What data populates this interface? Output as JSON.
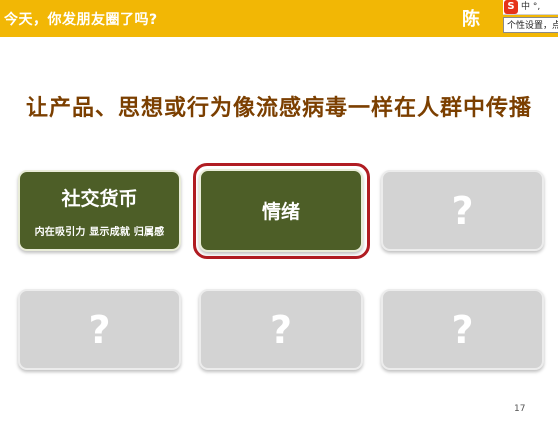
{
  "header": {
    "title": "今天，你发朋友圈了吗?",
    "right_partial": "陈",
    "ime_logo": "S",
    "ime_text": "中 °,"
  },
  "tooltip": {
    "text": "个性设置，点"
  },
  "slide": {
    "title": "让产品、思想或行为像流感病毒一样在人群中传播",
    "cards": [
      {
        "label": "社交货币",
        "sub": "内在吸引力 显示成就 归属感"
      },
      {
        "label": "情绪"
      },
      {
        "label": "?"
      },
      {
        "label": "?"
      },
      {
        "label": "?"
      },
      {
        "label": "?"
      }
    ],
    "page_number": "17"
  },
  "colors": {
    "header": "#f2b705",
    "title": "#7b3f00",
    "card_green": "#4d5e27",
    "card_gray": "#d3d3d3",
    "highlight": "#b01c22"
  }
}
